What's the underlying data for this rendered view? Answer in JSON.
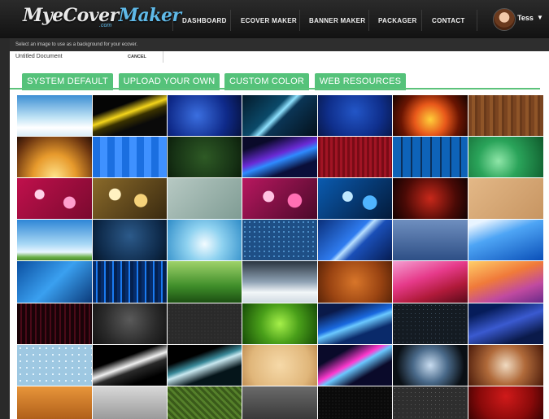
{
  "nav": {
    "logo_main": "MyeCover",
    "logo_maker": "Maker",
    "logo_sub": ".com",
    "items": [
      "DASHBOARD",
      "ECOVER MAKER",
      "BANNER MAKER",
      "PACKAGER",
      "CONTACT"
    ],
    "user_name": "Tess",
    "user_caret": "▼"
  },
  "hint": "Select an image to use as a background for your ecover.",
  "document": {
    "name": "Untitled Document",
    "cancel_label": "CANCEL"
  },
  "tabs": [
    "SYSTEM DEFAULT",
    "UPLOAD YOUR OWN",
    "CUSTOM COLOR",
    "WEB RESOURCES"
  ],
  "colors": {
    "tab_green": "#55c27a",
    "nav_bg": "#1c1c1c",
    "logo_accent": "#5fb9e8"
  },
  "backgrounds": [
    [
      "sky-white-blue",
      "yellow-light-streaks",
      "blue-starry",
      "teal-diagonal-lines",
      "navy-blue",
      "orange-flames",
      "brown-wood"
    ],
    [
      "golden-sunset-glow",
      "blue-pixel-squares",
      "green-dotted",
      "purple-blue-swoosh",
      "red-stripes",
      "blue-tiles",
      "green-swirl"
    ],
    [
      "pink-bokeh",
      "gold-bokeh",
      "gray-green-texture",
      "magenta-bokeh",
      "blue-bokeh",
      "red-smoke",
      "tan-cork"
    ],
    [
      "blue-sky-clouds",
      "blue-dark-floral",
      "light-blue-glow",
      "blue-dot-pattern",
      "blue-diagonal-rays",
      "steel-blue",
      "blue-wave-light"
    ],
    [
      "blue-lightning",
      "blue-vertical-lines",
      "green-grass",
      "gray-clouds",
      "orange-grunge",
      "pink-red-swoosh",
      "orange-purple-waves"
    ],
    [
      "dark-red-stripes",
      "dark-gray-gradient",
      "charcoal-texture",
      "green-radial",
      "blue-swoosh-dark",
      "dark-dots",
      "navy-swirl"
    ],
    [
      "water-droplets",
      "black-white-swoosh",
      "black-teal-curves",
      "beige-parchment",
      "neon-streaks",
      "smoke-blue",
      "brown-smoke"
    ],
    [
      "orange-texture",
      "silver-gray",
      "green-fabric",
      "gray-metal",
      "black-carbon",
      "dark-gray-mesh",
      "red-velvet"
    ]
  ]
}
